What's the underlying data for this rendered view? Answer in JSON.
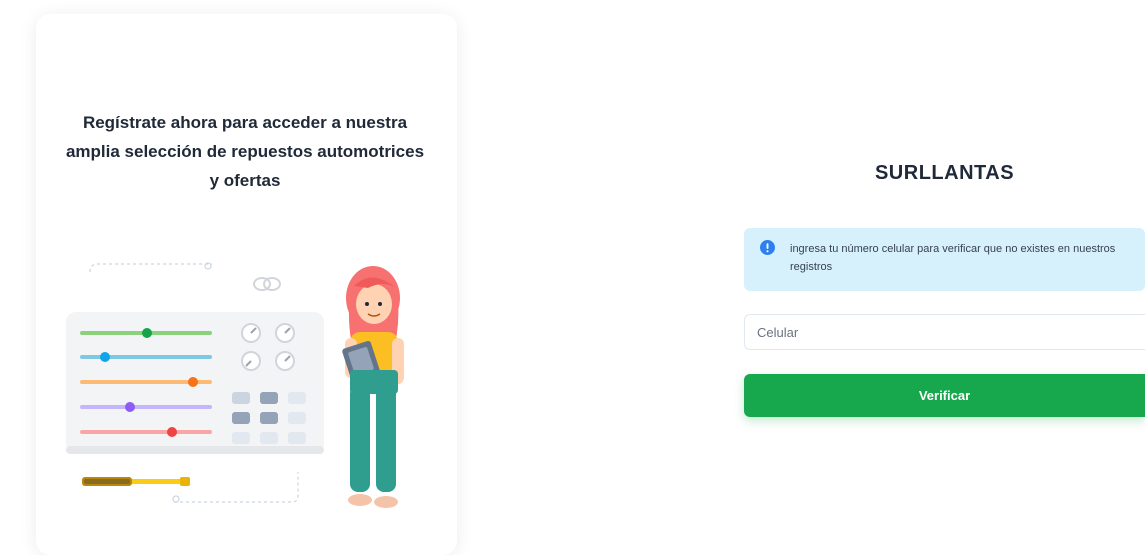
{
  "promo": {
    "tagline": "Regístrate ahora para acceder a nuestra amplia selección de repuestos automotrices y ofertas",
    "illustration_icon": "person-with-clipboard-and-settings-panel"
  },
  "form": {
    "brand": "SURLLANTAS",
    "alert": {
      "icon": "info-icon",
      "text": "ingresa tu número celular para verificar que no existes en nuestros registros"
    },
    "phone_placeholder": "Celular",
    "verify_label": "Verificar"
  },
  "colors": {
    "primary_green": "#17a84d",
    "alert_background": "#d6f1fb",
    "info_icon_blue": "#2f80ed"
  }
}
